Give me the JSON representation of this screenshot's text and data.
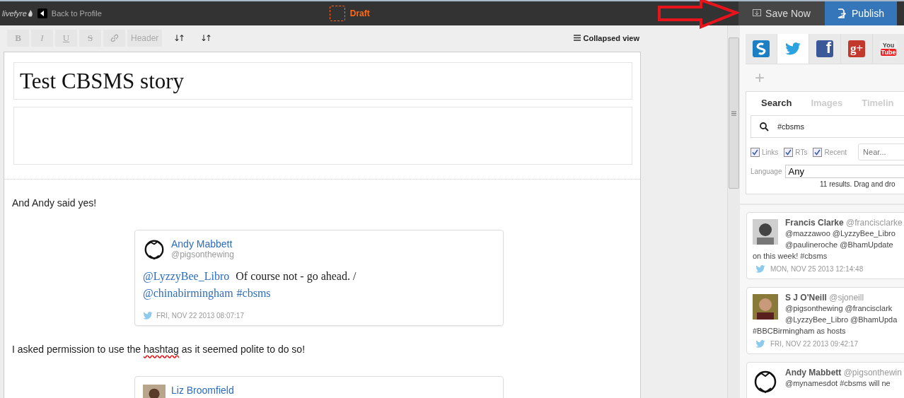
{
  "topbar": {
    "logo": "livefyre",
    "back": "Back to Profile",
    "status": "Draft",
    "save": "Save Now",
    "publish": "Publish"
  },
  "toolbar": {
    "buttons": [
      {
        "kind": "bold",
        "label": "B"
      },
      {
        "kind": "italic",
        "label": "I"
      },
      {
        "kind": "underline",
        "label": "U"
      },
      {
        "kind": "strike",
        "label": "S"
      },
      {
        "kind": "link"
      },
      {
        "kind": "text",
        "label": "Header"
      },
      {
        "kind": "sort",
        "label": "↓↑"
      },
      {
        "kind": "sort",
        "label": "↓↑"
      }
    ],
    "view": "Collapsed view"
  },
  "story": {
    "title": "Test CBSMS story",
    "blocks": [
      {
        "kind": "paragraph",
        "segments": [
          {
            "kind": "text",
            "text": "And Andy said yes!"
          }
        ]
      },
      {
        "kind": "tweet",
        "name": "Andy Mabbett",
        "handle": "@pigsonthewing",
        "segments": [
          {
            "kind": "link",
            "text": "@LyzzyBee_Libro"
          },
          {
            "kind": "text",
            "text": " Of course not - go ahead. / "
          },
          {
            "kind": "link",
            "text": "@chinabirmingham"
          },
          {
            "kind": "link",
            "text": "#cbsms"
          }
        ],
        "time": "FRI, NOV 22 2013 08:07:17"
      },
      {
        "kind": "paragraph",
        "segments": [
          {
            "kind": "text",
            "text": "I asked permission to use the "
          },
          {
            "kind": "misspelled",
            "text": "hashtag"
          },
          {
            "kind": "text",
            "text": " as it seemed polite to do so!"
          }
        ]
      },
      {
        "kind": "tweet",
        "name": "Liz Broomfield"
      }
    ]
  },
  "sources": [
    {
      "kind": "storify",
      "selected": false
    },
    {
      "kind": "twitter",
      "selected": true
    },
    {
      "kind": "facebook",
      "glyph": "f",
      "selected": false
    },
    {
      "kind": "googleplus",
      "glyph": "g+",
      "selected": false
    },
    {
      "kind": "youtube",
      "glyph": [
        "You",
        "Tube"
      ],
      "selected": false
    }
  ],
  "add": "+",
  "search": {
    "tabs": [
      {
        "label": "Search",
        "selected": true
      },
      {
        "label": "Images",
        "selected": false
      },
      {
        "label": "Timelin",
        "selected": false
      }
    ],
    "query": "#cbsms",
    "filters": [
      {
        "label": "Links",
        "checked": true
      },
      {
        "label": "RTs",
        "checked": true
      },
      {
        "label": "Recent",
        "checked": true
      }
    ],
    "near_placeholder": "Near...",
    "language_label": "Language",
    "language": "Any",
    "results": "11 results. Drag and dro"
  },
  "feed": [
    {
      "name": "Francis Clarke",
      "handle": "@francisclarke",
      "lines": [
        "@mazzawoo @LyzzyBee_Libro",
        "@paulineroche @BhamUpdate",
        "on this week! #cbsms"
      ],
      "time": "MON, NOV 25 2013 12:14:48"
    },
    {
      "name": "S J O'Neill",
      "handle": "@sjoneill",
      "lines": [
        "@pigsonthewing @francisclark",
        "@LyzzyBee_Libro @BhamUpda",
        "#BBCBirmingham as hosts"
      ],
      "time": "FRI, NOV 22 2013 09:42:17"
    },
    {
      "name": "Andy Mabbett",
      "handle": "@pigsonthewin",
      "lines": [
        "@mynamesdot #cbsms will ne"
      ]
    }
  ]
}
